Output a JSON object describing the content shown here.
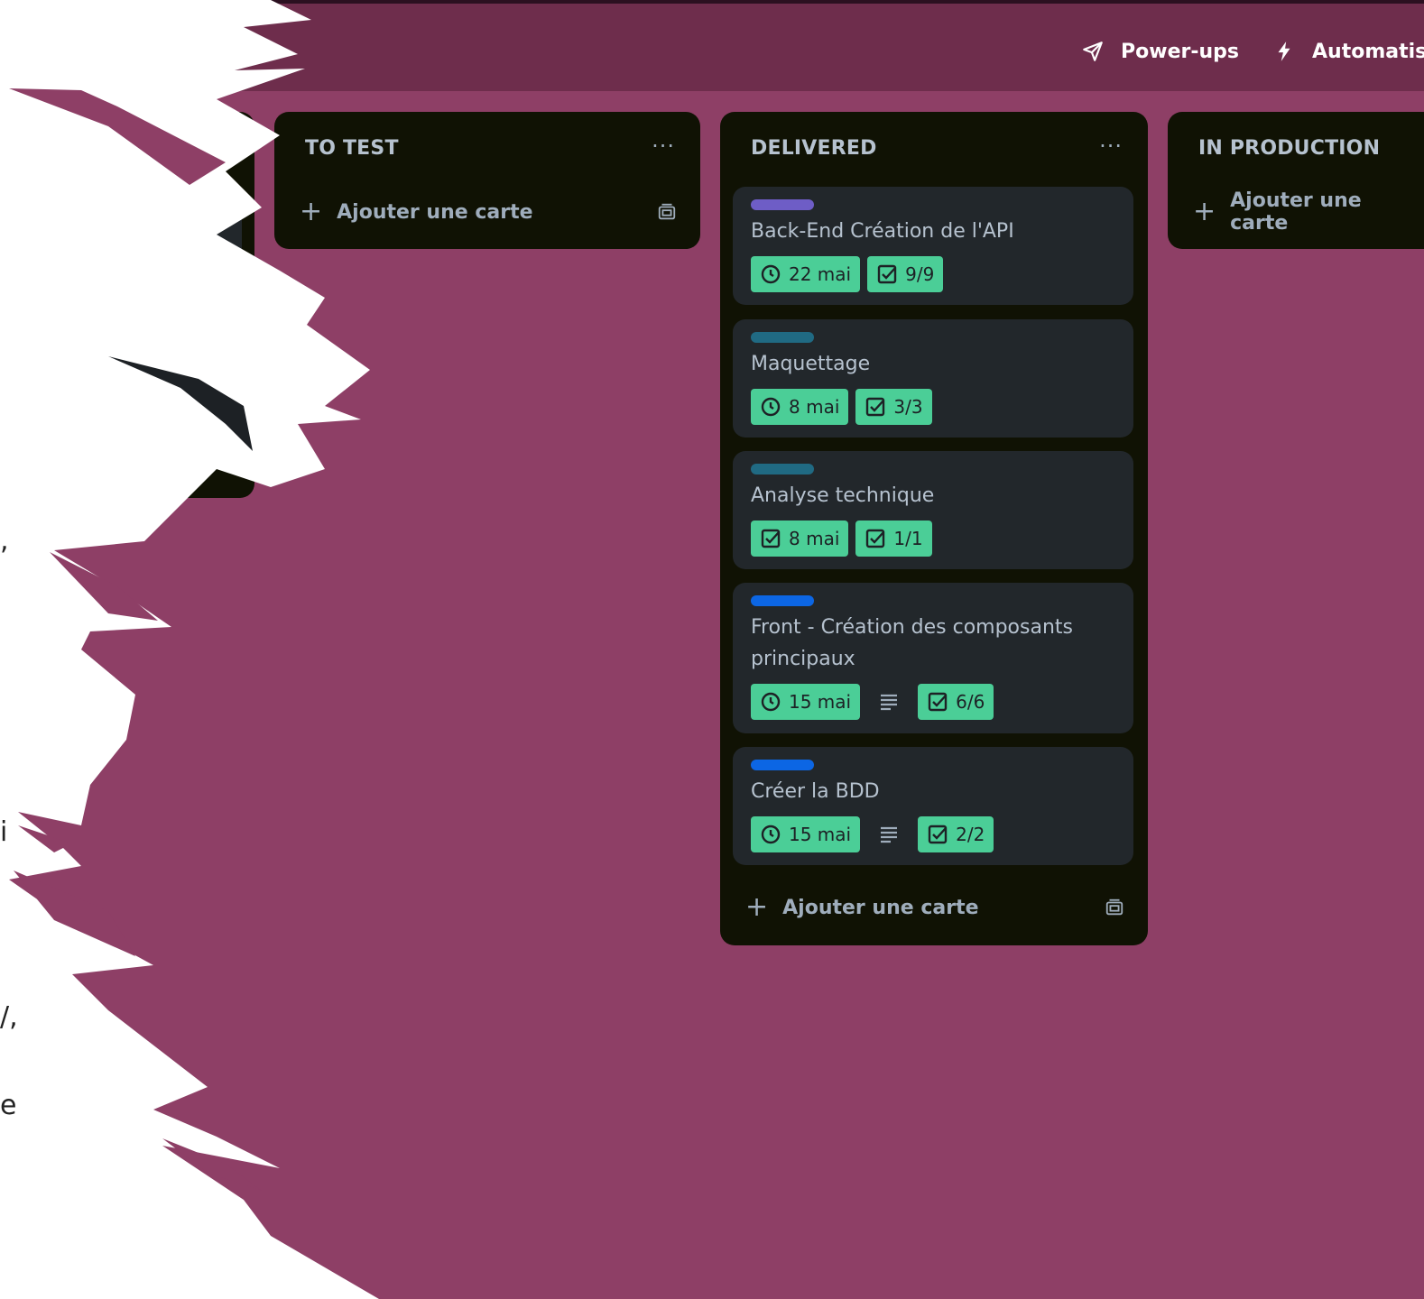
{
  "topbar": {
    "powerups_label": "Power-ups",
    "automation_label": "Automatisa"
  },
  "lists": {
    "to_test": {
      "title": "TO TEST",
      "menu": "···",
      "add_label": "Ajouter une carte"
    },
    "delivered": {
      "title": "DELIVERED",
      "menu": "···",
      "add_label": "Ajouter une carte",
      "cards": [
        {
          "title": "Back-End Création de l'API",
          "label_color": "#6e5dc6",
          "date": "22 mai",
          "date_icon": "clock-icon",
          "checklist": "9/9"
        },
        {
          "title": "Maquettage",
          "label_color": "#206a83",
          "date": "8 mai",
          "date_icon": "clock-icon",
          "checklist": "3/3"
        },
        {
          "title": "Analyse technique",
          "label_color": "#206a83",
          "date": "8 mai",
          "date_icon": "check-square-icon",
          "checklist": "1/1"
        },
        {
          "title": "Front - Création des composants principaux",
          "label_color": "#0c66e4",
          "date": "15 mai",
          "date_icon": "clock-icon",
          "has_description": true,
          "checklist": "6/6"
        },
        {
          "title": "Créer la BDD",
          "label_color": "#0c66e4",
          "date": "15 mai",
          "date_icon": "clock-icon",
          "has_description": true,
          "checklist": "2/2"
        }
      ]
    },
    "in_production": {
      "title": "IN PRODUCTION",
      "add_label": "Ajouter une carte"
    },
    "partial_left": {
      "menu": "···"
    }
  },
  "colors": {
    "board_background": "#8e3f66",
    "topbar_background": "#6e2d4c",
    "list_background": "#101204",
    "card_background": "#22272b",
    "badge_green": "#4bce97"
  },
  "left_fragments": [
    ",",
    "i",
    "/,",
    "e"
  ]
}
